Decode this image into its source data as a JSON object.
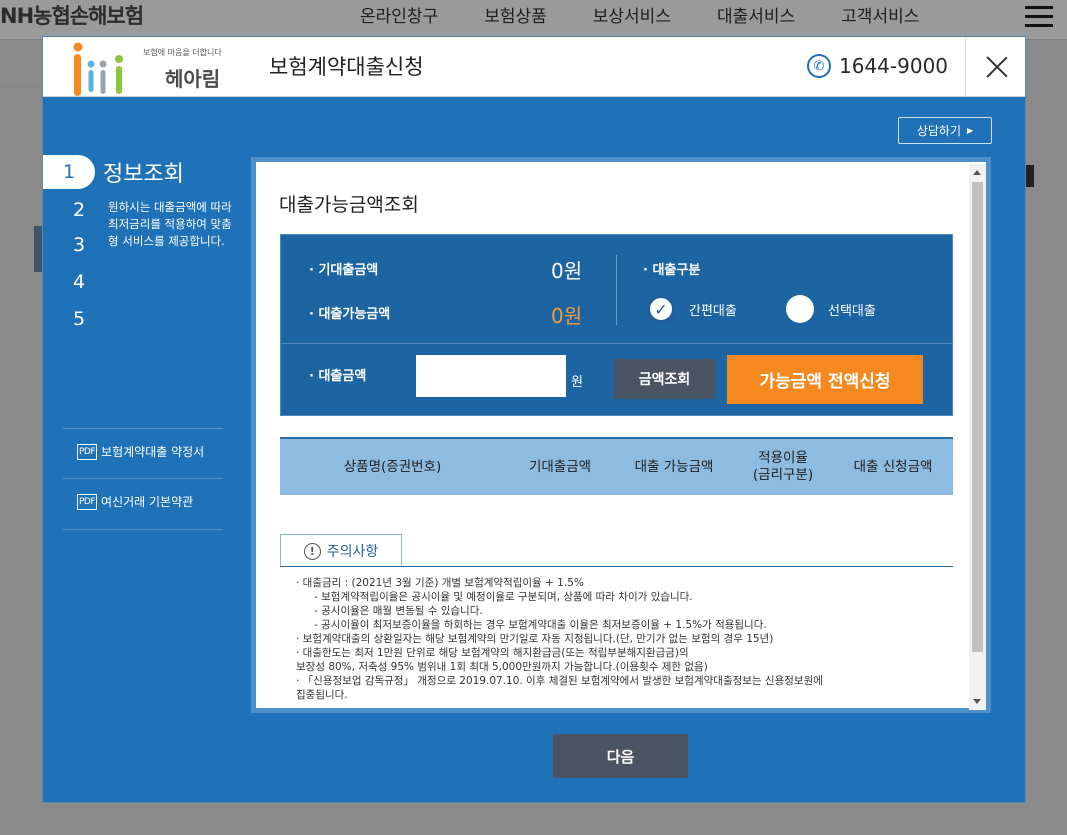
{
  "site": {
    "logo_text": "NH농협손해보험",
    "nav": [
      "온라인창구",
      "보험상품",
      "보상서비스",
      "대출서비스",
      "고객서비스"
    ]
  },
  "modal": {
    "brand_tagline": "보험에 마음을 더합니다",
    "brand_name": "헤아림",
    "title": "보험계약대출신청",
    "phone": "1644-9000",
    "consult_label": "상담하기"
  },
  "steps": {
    "active_num": "1",
    "active_label": "정보조회",
    "others": [
      "2",
      "3",
      "4",
      "5"
    ],
    "description": "원하시는 대출금액에 따라 최저금리를 적용하여 맞춤형 서비스를 제공합니다."
  },
  "sidebar": {
    "pdf_badge": "PDF",
    "links": [
      "보험계약대출 약정서",
      "여신거래 기본약관"
    ]
  },
  "inquiry": {
    "title": "대출가능금액조회",
    "existing_loan_label": "· 기대출금액",
    "existing_loan_value": "0원",
    "available_label": "· 대출가능금액",
    "available_value": "0원",
    "type_label": "· 대출구분",
    "type_options": [
      "간편대출",
      "선택대출"
    ],
    "selected_type": "간편대출",
    "amount_label": "· 대출금액",
    "amount_value": "",
    "amount_unit": "원",
    "lookup_button": "금액조회",
    "apply_all_button": "가능금액 전액신청"
  },
  "table": {
    "headers": [
      "상품명(증권번호)",
      "기대출금액",
      "대출 가능금액",
      "적용이율\n(금리구분)",
      "대출 신청금액"
    ]
  },
  "notice": {
    "tab_label": "주의사항",
    "lines": [
      "· 대출금리 : (2021년 3월 기준) 개별 보험계약적립이율 + 1.5%",
      "- 보험계약적립이율은 공시이율 및 예정이율로 구분되며, 상품에 따라 차이가 있습니다.",
      "- 공시이율은 매월 변동될 수 있습니다.",
      "- 공시이율이 최저보증이율을 하회하는 경우 보험계약대출 이율은 최저보증이율 + 1.5%가 적용됩니다.",
      "· 보험계약대출의 상환일자는 해당 보험계약의 만기일로 자동 지정됩니다.(단, 만기가 없는 보험의 경우 15년)",
      "· 대출한도는 최저 1만원 단위로 해당 보험계약의 해지환급금(또는 적립부분해지환급금)의",
      "보장성 80%, 저축성 95% 범위내 1회 최대 5,000만원까지 가능합니다.(이용횟수 제한 없음)",
      "· 「신용정보업 감독규정」 개정으로 2019.07.10. 이후 체결된 보험계약에서 발생한 보험계약대출정보는 신용정보원에",
      "집중됩니다."
    ]
  },
  "next_button": "다음",
  "colors": {
    "modal_bg": "#1f72b8",
    "accent_orange": "#f5891f",
    "button_gray": "#4b5462",
    "table_header": "#8ebbe0"
  }
}
